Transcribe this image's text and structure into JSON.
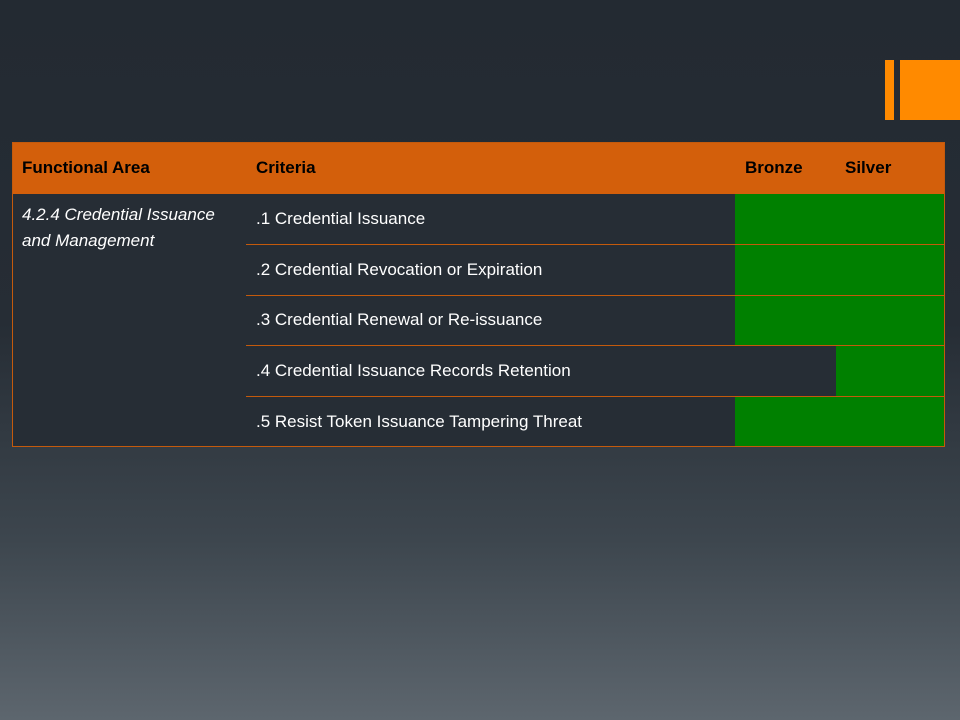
{
  "table": {
    "headers": {
      "functional_area": "Functional Area",
      "criteria": "Criteria",
      "bronze": "Bronze",
      "silver": "Silver"
    },
    "functional_area": "4.2.4 Credential Issuance and Management",
    "rows": [
      {
        "criteria": ".1  Credential Issuance",
        "bronze": true,
        "silver": true
      },
      {
        "criteria": ".2  Credential Revocation or Expiration",
        "bronze": true,
        "silver": true
      },
      {
        "criteria": ".3  Credential Renewal or Re-issuance",
        "bronze": true,
        "silver": true
      },
      {
        "criteria": ".4  Credential Issuance Records Retention",
        "bronze": false,
        "silver": true
      },
      {
        "criteria": ".5 Resist Token Issuance  Tampering Threat",
        "bronze": true,
        "silver": true
      }
    ]
  },
  "colors": {
    "header_bg": "#d35f0b",
    "met_fill": "#008000",
    "accent": "#ff8a00",
    "background": "#262d35"
  }
}
